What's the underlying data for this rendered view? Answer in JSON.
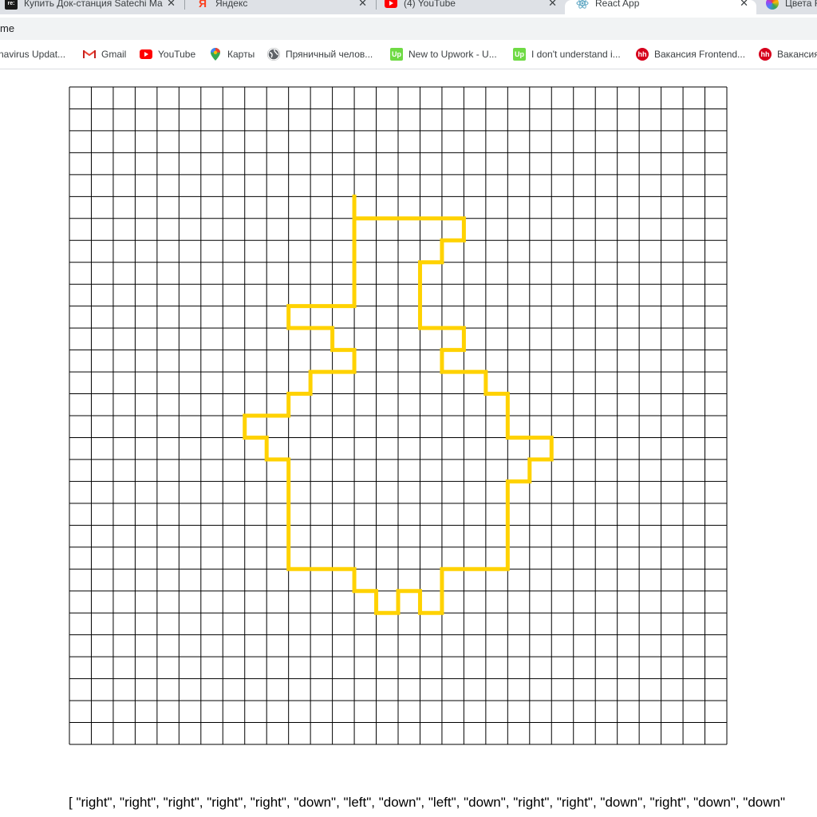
{
  "tabs": [
    {
      "title": "Купить Док-станция Satechi Ма",
      "icon": "re-store-icon",
      "close": "✕"
    },
    {
      "title": "Яндекс",
      "icon": "yandex-icon",
      "close": "✕"
    },
    {
      "title": "(4) YouTube",
      "icon": "youtube-icon",
      "close": "✕"
    },
    {
      "title": "React App",
      "icon": "react-icon",
      "close": "✕",
      "active": true
    },
    {
      "title": "Цвета F",
      "icon": "color-wheel-icon"
    }
  ],
  "address_bar": {
    "url": "me"
  },
  "bookmarks": [
    {
      "label": "navirus Updat...",
      "icon": ""
    },
    {
      "label": "Gmail",
      "icon": "gmail-icon"
    },
    {
      "label": "YouTube",
      "icon": "youtube-icon"
    },
    {
      "label": "Карты",
      "icon": "maps-icon"
    },
    {
      "label": "Пряничный челов...",
      "icon": "globe-icon"
    },
    {
      "label": "New to Upwork - U...",
      "icon": "upwork-icon"
    },
    {
      "label": "I don't understand i...",
      "icon": "upwork-icon"
    },
    {
      "label": "Вакансия Frontend...",
      "icon": "hh-icon"
    },
    {
      "label": "Вакансия",
      "icon": "hh-icon"
    }
  ],
  "grid": {
    "columns": 30,
    "rows": 30,
    "line_color": "#000000",
    "path_color": "#ffd200"
  },
  "drawing": {
    "start_cell": [
      13,
      6
    ],
    "moves": [
      "right",
      "right",
      "right",
      "right",
      "right",
      "down",
      "left",
      "down",
      "left",
      "down",
      "down",
      "down",
      "right",
      "right",
      "down",
      "left",
      "down",
      "right",
      "right",
      "down",
      "right",
      "down",
      "down",
      "right",
      "right",
      "down",
      "left",
      "down",
      "left",
      "down",
      "down",
      "down",
      "down",
      "left",
      "left",
      "left",
      "down",
      "down",
      "left",
      "up",
      "left",
      "down",
      "left",
      "up",
      "left",
      "up",
      "left",
      "left",
      "left",
      "up",
      "up",
      "up",
      "up",
      "up",
      "left",
      "up",
      "left",
      "up",
      "right",
      "right",
      "up",
      "right",
      "up",
      "right",
      "right",
      "up",
      "left",
      "up",
      "left",
      "left",
      "up",
      "right",
      "right",
      "right",
      "up",
      "up",
      "up",
      "up",
      "up"
    ],
    "printed_moves": "[ \"right\", \"right\", \"right\", \"right\", \"right\", \"down\", \"left\", \"down\", \"left\", \"down\", \"right\", \"right\", \"down\", \"right\", \"down\", \"down\""
  },
  "icons": {
    "re_store": "#1a1a1a",
    "yandex": "#fc3f1d",
    "youtube": "#ff0000",
    "upwork": "#6fda44",
    "hh": "#d6001c",
    "maps": "#34a853"
  }
}
